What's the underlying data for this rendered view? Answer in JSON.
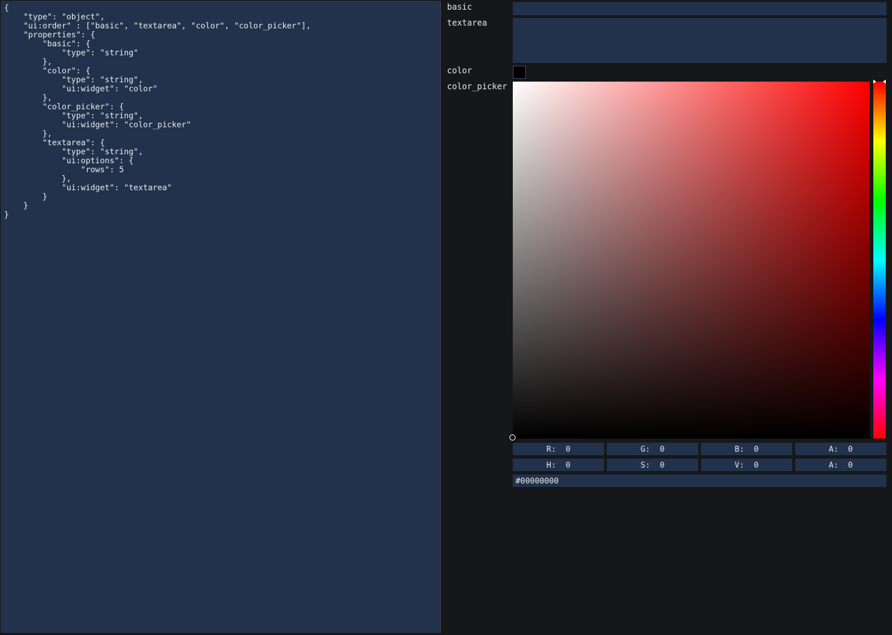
{
  "editor": {
    "json_text": "{\n    \"type\": \"object\",\n    \"ui:order\" : [\"basic\", \"textarea\", \"color\", \"color_picker\"],\n    \"properties\": {\n        \"basic\": {\n            \"type\": \"string\"\n        },\n        \"color\": {\n            \"type\": \"string\",\n            \"ui:widget\": \"color\"\n        },\n        \"color_picker\": {\n            \"type\": \"string\",\n            \"ui:widget\": \"color_picker\"\n        },\n        \"textarea\": {\n            \"type\": \"string\",\n            \"ui:options\": {\n                \"rows\": 5\n            },\n            \"ui:widget\": \"textarea\"\n        }\n    }\n}"
  },
  "form": {
    "basic": {
      "label": "basic",
      "value": ""
    },
    "textarea": {
      "label": "textarea",
      "value": ""
    },
    "color": {
      "label": "color",
      "value": "#000000"
    },
    "color_picker": {
      "label": "color_picker",
      "hue": 0,
      "saturation": 0,
      "value": 0,
      "channels_rgba": [
        {
          "label": "R:",
          "value": "0"
        },
        {
          "label": "G:",
          "value": "0"
        },
        {
          "label": "B:",
          "value": "0"
        },
        {
          "label": "A:",
          "value": "0"
        }
      ],
      "channels_hsva": [
        {
          "label": "H:",
          "value": "0"
        },
        {
          "label": "S:",
          "value": "0"
        },
        {
          "label": "V:",
          "value": "0"
        },
        {
          "label": "A:",
          "value": "0"
        }
      ],
      "hex": "#00000000"
    }
  },
  "colors": {
    "background": "#161719",
    "field": "#22324d",
    "text": "#e8e8e8"
  }
}
